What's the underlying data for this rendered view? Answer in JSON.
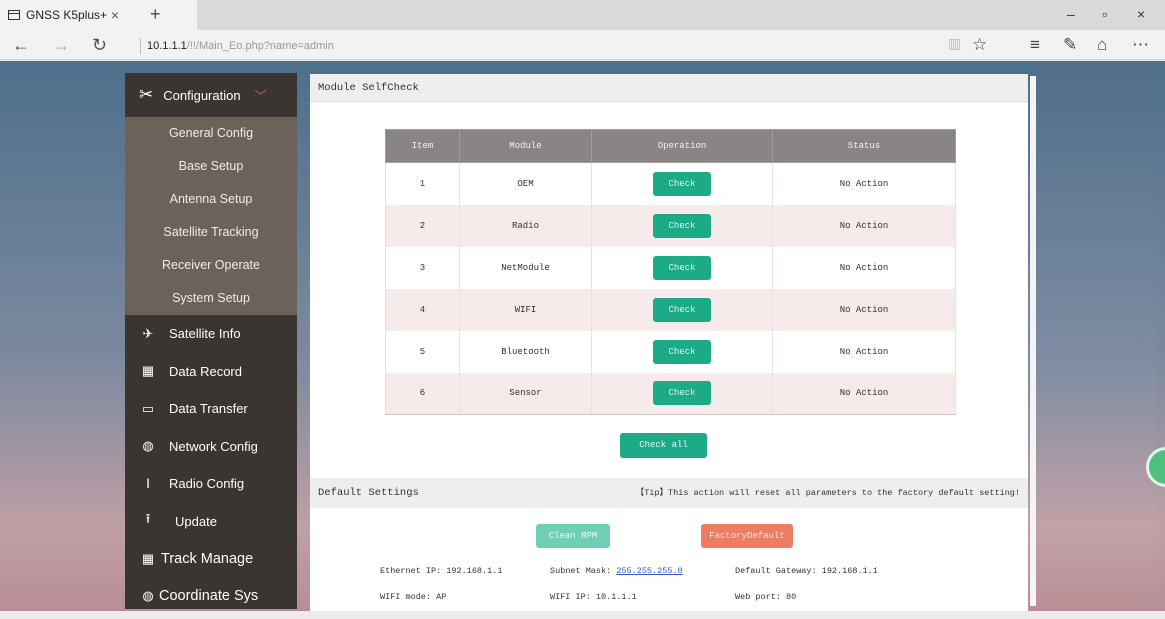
{
  "browser": {
    "tab_title": "GNSS K5plus+",
    "tab_close": "×",
    "tab_new": "+",
    "url_host": "10.1.1.1",
    "url_path": "/!!/Main_Eo.php?name=admin",
    "win_min": "–",
    "win_max": "▫",
    "win_close": "×"
  },
  "sidebar": {
    "configuration": "Configuration",
    "sub_items": [
      "General Config",
      "Base Setup",
      "Antenna Setup",
      "Satellite Tracking",
      "Receiver Operate",
      "System Setup"
    ],
    "items": [
      "Satellite Info",
      "Data Record",
      "Data Transfer",
      "Network Config",
      "Radio Config",
      "Update",
      "Track Manage",
      "Coordinate Sys"
    ]
  },
  "selfcheck": {
    "title": "Module SelfCheck",
    "headers": [
      "Item",
      "Module",
      "Operation",
      "Status"
    ],
    "rows": [
      {
        "item": "1",
        "module": "OEM",
        "button": "Check",
        "status": "No Action"
      },
      {
        "item": "2",
        "module": "Radio",
        "button": "Check",
        "status": "No Action"
      },
      {
        "item": "3",
        "module": "NetModule",
        "button": "Check",
        "status": "No Action"
      },
      {
        "item": "4",
        "module": "WIFI",
        "button": "Check",
        "status": "No Action"
      },
      {
        "item": "5",
        "module": "Bluetooth",
        "button": "Check",
        "status": "No Action"
      },
      {
        "item": "6",
        "module": "Sensor",
        "button": "Check",
        "status": "No Action"
      }
    ],
    "check_all": "Check all"
  },
  "defaults": {
    "title": "Default Settings",
    "tip": "【Tip】This action will reset all parameters to the factory default setting!",
    "clean_rpm": "Clean RPM",
    "factory_default": "FactoryDefault",
    "ethernet_ip_label": "Ethernet IP:",
    "ethernet_ip": "192.168.1.1",
    "subnet_label": "Subnet Mask:",
    "subnet": "255.255.255.0",
    "gateway_label": "Default Gateway:",
    "gateway": "192.168.1.1",
    "wifi_mode_label": "WIFI mode:",
    "wifi_mode": "AP",
    "wifi_ip_label": "WIFI IP:",
    "wifi_ip": "10.1.1.1",
    "web_port_label": "Web port:",
    "web_port": "80"
  },
  "colors": {
    "sidebar": "#3a3531",
    "submenu": "#6c625a",
    "check_button": "#1daa86",
    "factory_button": "#ed7d62",
    "table_header": "#8a8585"
  }
}
